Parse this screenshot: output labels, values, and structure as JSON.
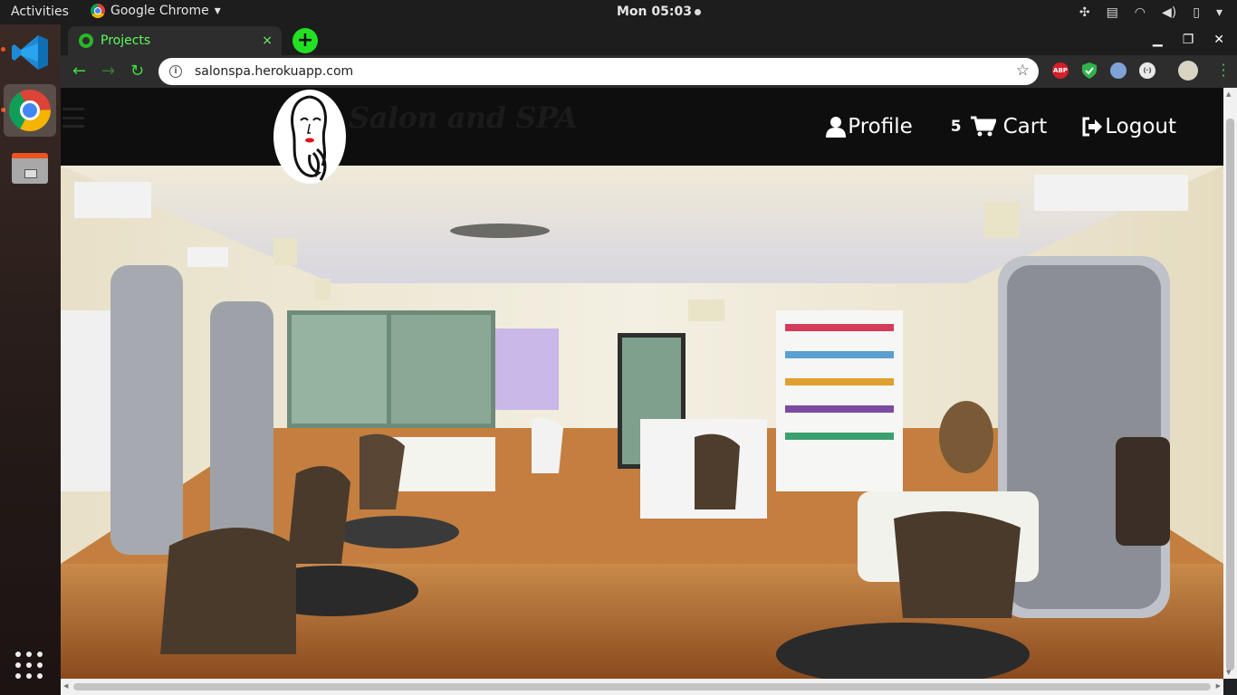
{
  "system_bar": {
    "activities": "Activities",
    "app_name": "Google Chrome",
    "clock": "Mon 05:03"
  },
  "browser": {
    "tab_title": "Projects",
    "tab_close": "×",
    "new_tab": "+",
    "url": "salonspa.herokuapp.com",
    "extensions": [
      "ABP",
      "shield",
      "privacy",
      "rss",
      "profile"
    ],
    "accent_color": "#22e022"
  },
  "site": {
    "brand": "Salon and SPA",
    "nav": {
      "profile": "Profile",
      "cart_count": "5",
      "cart": "Cart",
      "logout": "Logout"
    },
    "hero_alt": "Salon interior"
  }
}
